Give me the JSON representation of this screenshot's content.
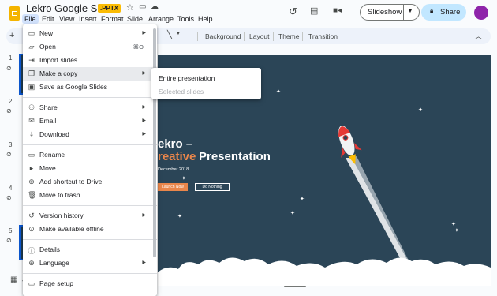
{
  "app": {
    "doc_title": "Lekro Google Slides",
    "format_badge": ".PPTX",
    "menu": [
      "File",
      "Edit",
      "View",
      "Insert",
      "Format",
      "Slide",
      "Arrange",
      "Tools",
      "Help"
    ],
    "slideshow_label": "Slideshow",
    "share_label": "Share"
  },
  "toolbar": {
    "background": "Background",
    "layout": "Layout",
    "theme": "Theme",
    "transition": "Transition"
  },
  "filmstrip": {
    "numbers": [
      "1",
      "2",
      "3",
      "4",
      "5"
    ]
  },
  "file_menu": {
    "items": [
      {
        "label": "New",
        "icon": "new-slides-icon",
        "submenu": true
      },
      {
        "label": "Open",
        "icon": "folder-open-icon",
        "shortcut": "⌘O"
      },
      {
        "label": "Import slides",
        "icon": "import-icon"
      },
      {
        "label": "Make a copy",
        "icon": "copy-icon",
        "submenu": true,
        "highlighted": true
      },
      {
        "label": "Save as Google Slides",
        "icon": "save-icon"
      },
      {
        "label": "Share",
        "icon": "person-add-icon",
        "submenu": true
      },
      {
        "label": "Email",
        "icon": "email-icon",
        "submenu": true
      },
      {
        "label": "Download",
        "icon": "download-icon",
        "submenu": true
      },
      {
        "label": "Rename",
        "icon": "rename-icon"
      },
      {
        "label": "Move",
        "icon": "move-icon"
      },
      {
        "label": "Add shortcut to Drive",
        "icon": "shortcut-icon"
      },
      {
        "label": "Move to trash",
        "icon": "trash-icon"
      },
      {
        "label": "Version history",
        "icon": "history-icon",
        "submenu": true
      },
      {
        "label": "Make available offline",
        "icon": "offline-icon"
      },
      {
        "label": "Details",
        "icon": "info-icon"
      },
      {
        "label": "Language",
        "icon": "globe-icon",
        "submenu": true
      },
      {
        "label": "Page setup",
        "icon": "page-setup-icon"
      }
    ]
  },
  "copy_submenu": {
    "items": [
      {
        "label": "Entire presentation",
        "enabled": true
      },
      {
        "label": "Selected slides",
        "enabled": false
      }
    ]
  },
  "slide": {
    "title_line1": "ekro –",
    "title_line2_accent": "reative",
    "title_line2_rest": "Presentation",
    "date": "December 2018",
    "launch_button": "Launch Now",
    "nothing_button": "Do Nothing"
  },
  "colors": {
    "accent_orange": "#e9864b",
    "slide_bg": "#2b4557",
    "share_bg": "#c2e7ff",
    "avatar": "#8e24aa"
  }
}
